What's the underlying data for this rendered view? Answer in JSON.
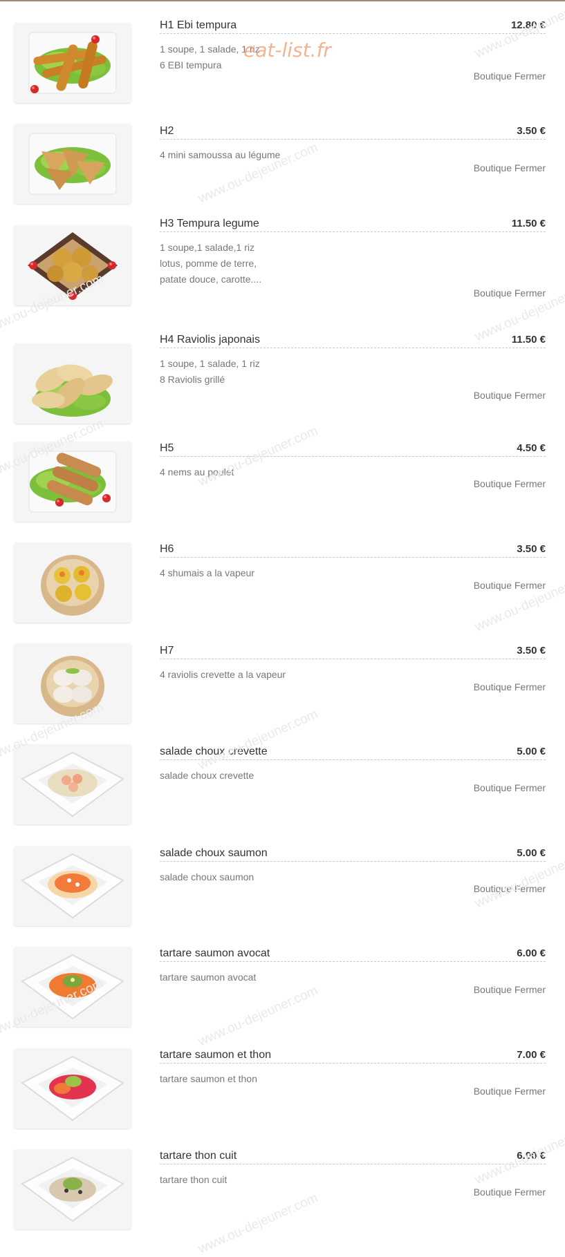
{
  "brand": {
    "logo_text": "eat-list.fr",
    "watermark": "www.ou-dejeuner.com"
  },
  "items": [
    {
      "name": "H1 Ebi tempura",
      "price": "12.80 €",
      "desc": [
        "1 soupe, 1 salade, 1 riz",
        "6 EBI tempura"
      ],
      "status": "Boutique Fermer",
      "image": "shrimp-tempura"
    },
    {
      "name": "H2",
      "price": "3.50 €",
      "desc": [
        "4 mini samoussa au légume"
      ],
      "status": "Boutique Fermer",
      "image": "samosa"
    },
    {
      "name": "H3 Tempura legume",
      "price": "11.50 €",
      "desc": [
        "1 soupe,1 salade,1 riz",
        "lotus, pomme de terre,",
        "patate douce, carotte...."
      ],
      "status": "Boutique Fermer",
      "image": "vegetable-tempura"
    },
    {
      "name": "H4 Raviolis japonais",
      "price": "11.50 €",
      "desc": [
        "1 soupe, 1 salade, 1 riz",
        "8 Raviolis grillé"
      ],
      "status": "Boutique Fermer",
      "image": "gyoza"
    },
    {
      "name": "H5",
      "price": "4.50 €",
      "desc": [
        "4 nems au poulet"
      ],
      "status": "Boutique Fermer",
      "image": "spring-rolls"
    },
    {
      "name": "H6",
      "price": "3.50 €",
      "desc": [
        "4 shumais a la vapeur"
      ],
      "status": "Boutique Fermer",
      "image": "shumai-steamer"
    },
    {
      "name": "H7",
      "price": "3.50 €",
      "desc": [
        "4 raviolis crevette a la vapeur"
      ],
      "status": "Boutique Fermer",
      "image": "har-gow-steamer"
    },
    {
      "name": "salade choux crevette",
      "price": "5.00 €",
      "desc": [
        "salade choux crevette"
      ],
      "status": "Boutique Fermer",
      "image": "cabbage-shrimp-bowl"
    },
    {
      "name": "salade choux saumon",
      "price": "5.00 €",
      "desc": [
        "salade choux saumon"
      ],
      "status": "Boutique Fermer",
      "image": "cabbage-salmon-bowl"
    },
    {
      "name": "tartare saumon avocat",
      "price": "6.00 €",
      "desc": [
        "tartare saumon avocat"
      ],
      "status": "Boutique Fermer",
      "image": "salmon-avocado-tartare"
    },
    {
      "name": "tartare saumon et thon",
      "price": "7.00 €",
      "desc": [
        "tartare saumon et thon"
      ],
      "status": "Boutique Fermer",
      "image": "salmon-tuna-tartare"
    },
    {
      "name": "tartare thon cuit",
      "price": "6.00 €",
      "desc": [
        "tartare thon cuit"
      ],
      "status": "Boutique Fermer",
      "image": "cooked-tuna-tartare"
    }
  ]
}
